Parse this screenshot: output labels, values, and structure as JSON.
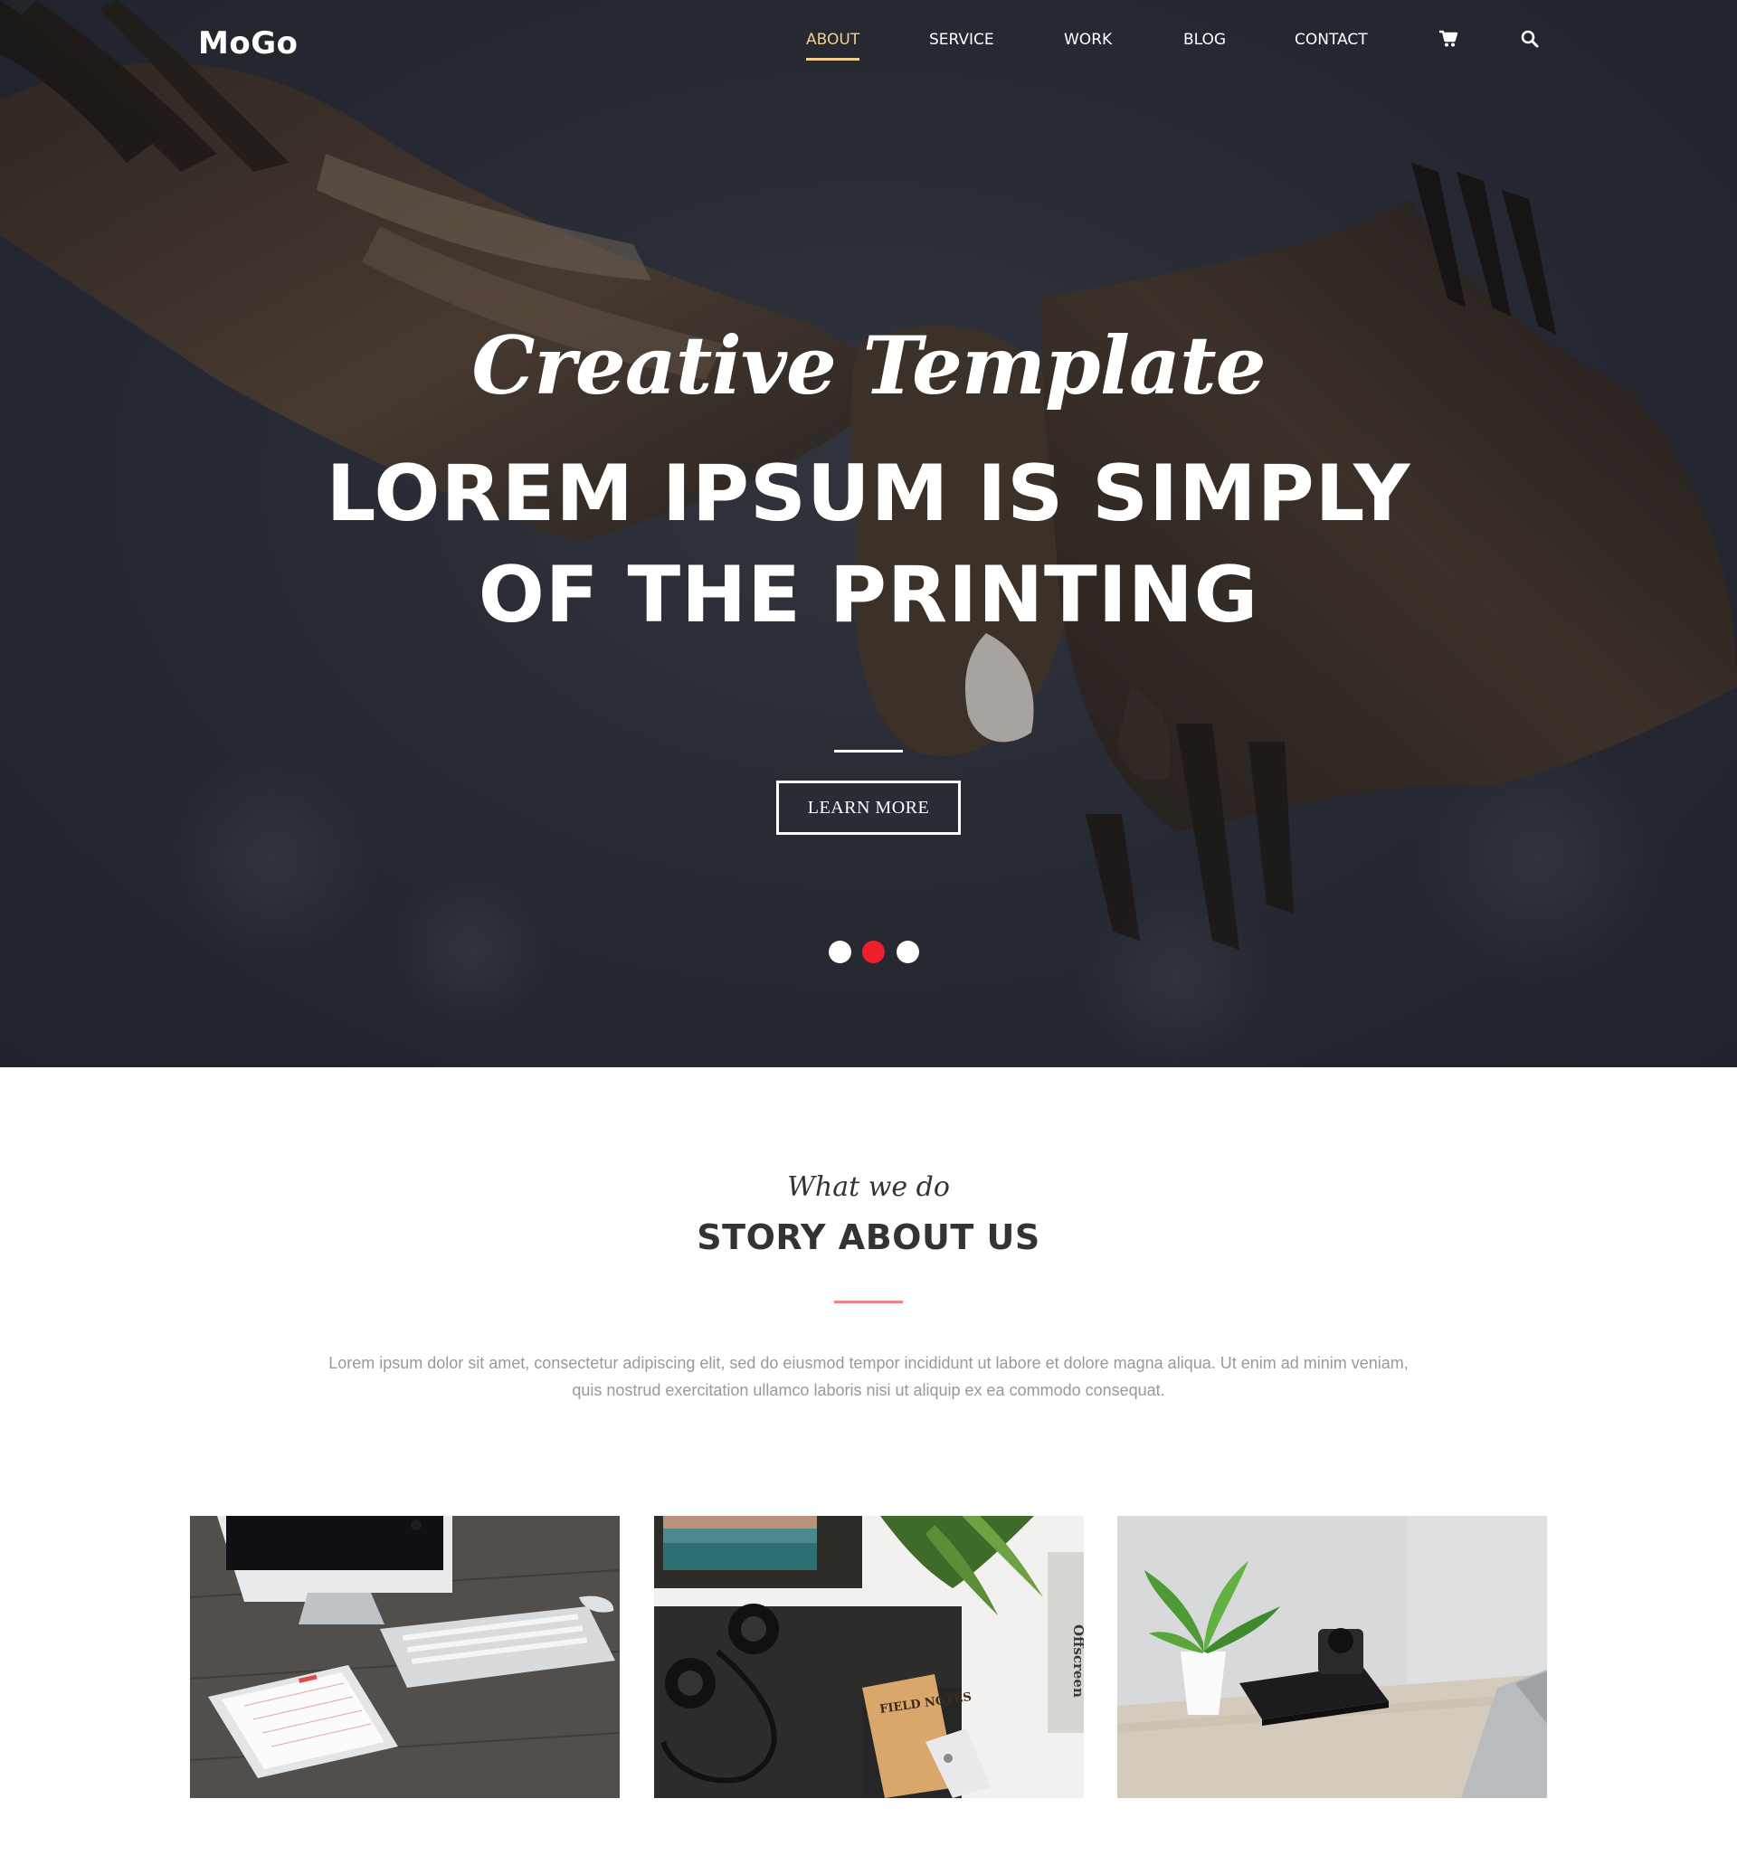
{
  "brand": {
    "logo": "MoGo"
  },
  "nav": {
    "items": [
      {
        "label": "ABOUT",
        "active": true
      },
      {
        "label": "SERVICE",
        "active": false
      },
      {
        "label": "WORK",
        "active": false
      },
      {
        "label": "BLOG",
        "active": false
      },
      {
        "label": "CONTACT",
        "active": false
      }
    ],
    "icons": [
      "cart-icon",
      "search-icon"
    ]
  },
  "hero": {
    "script": "Creative Template",
    "title_line1": "LOREM IPSUM IS SIMPLY",
    "title_line2": "OF THE PRINTING",
    "button": "LEARN MORE",
    "slides": {
      "count": 3,
      "active_index": 1
    }
  },
  "story": {
    "script": "What we do",
    "title": "STORY ABOUT US",
    "text": "Lorem ipsum dolor sit amet, consectetur adipiscing elit, sed do eiusmod tempor incididunt ut labore et dolore magna aliqua. Ut enim ad minim veniam, quis nostrud exercitation ullamco laboris nisi ut aliquip ex ea commodo consequat."
  },
  "photos": {
    "notebook_label": "FIELD NOTES",
    "book_label": "Offscreen"
  },
  "colors": {
    "accent_gold": "#f3d08a",
    "dot_active": "#f01f2c",
    "story_rule": "#f38181"
  }
}
